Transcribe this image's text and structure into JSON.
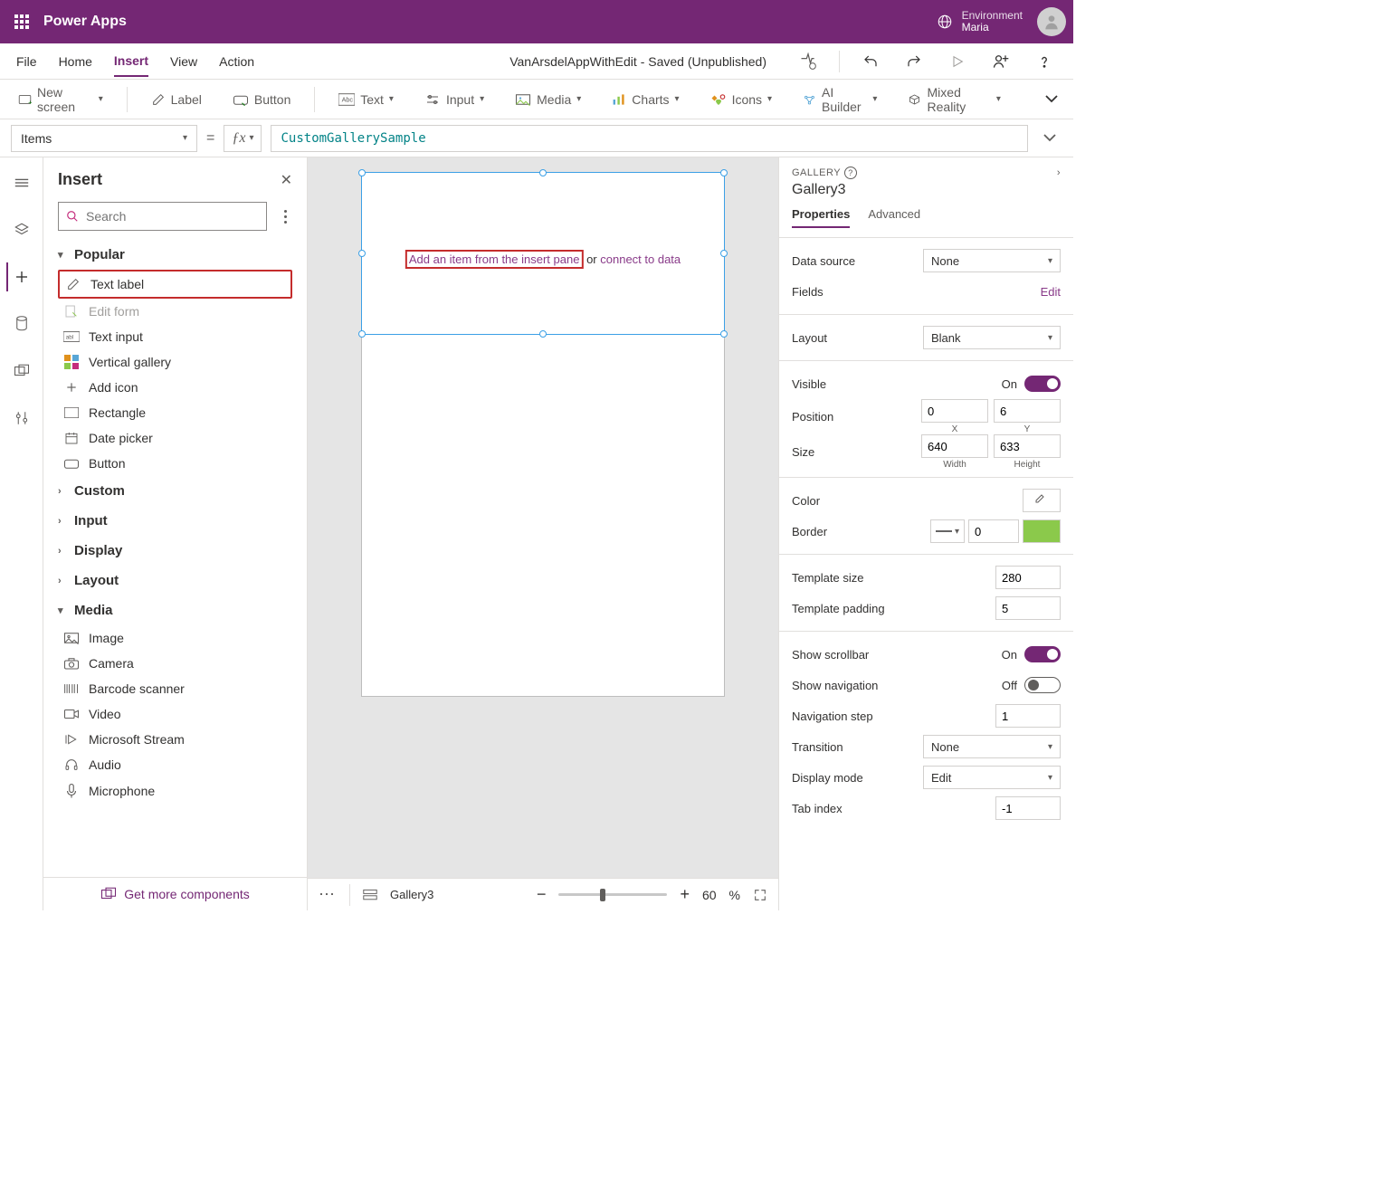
{
  "top": {
    "app_title": "Power Apps",
    "env_label": "Environment",
    "env_name": "Maria"
  },
  "menu": {
    "file": "File",
    "home": "Home",
    "insert": "Insert",
    "view": "View",
    "action": "Action",
    "doc": "VanArsdelAppWithEdit - Saved (Unpublished)"
  },
  "ribbon": {
    "new_screen": "New screen",
    "label": "Label",
    "button": "Button",
    "text": "Text",
    "input": "Input",
    "media": "Media",
    "charts": "Charts",
    "icons": "Icons",
    "ai_builder": "AI Builder",
    "mixed_reality": "Mixed Reality"
  },
  "formula": {
    "property": "Items",
    "value": "CustomGallerySample"
  },
  "panel": {
    "title": "Insert",
    "search_ph": "Search",
    "foot": "Get more components",
    "cats": {
      "popular": "Popular",
      "custom": "Custom",
      "input": "Input",
      "display": "Display",
      "layout": "Layout",
      "media": "Media"
    },
    "popular_items": {
      "text_label": "Text label",
      "edit_form": "Edit form",
      "text_input": "Text input",
      "vertical_gallery": "Vertical gallery",
      "add_icon": "Add icon",
      "rectangle": "Rectangle",
      "date_picker": "Date picker",
      "button": "Button"
    },
    "media_items": {
      "image": "Image",
      "camera": "Camera",
      "barcode": "Barcode scanner",
      "video": "Video",
      "ms_stream": "Microsoft Stream",
      "audio": "Audio",
      "microphone": "Microphone"
    }
  },
  "canvas": {
    "hint_boxed": "Add an item from the insert pane",
    "hint_mid": " or ",
    "hint_link": "connect to data",
    "crumb": "Gallery3",
    "zoom": "60",
    "pct": "%"
  },
  "props": {
    "ctx": "GALLERY",
    "name": "Gallery3",
    "tabs": {
      "properties": "Properties",
      "advanced": "Advanced"
    },
    "labels": {
      "data_source": "Data source",
      "fields": "Fields",
      "edit": "Edit",
      "layout": "Layout",
      "visible": "Visible",
      "position": "Position",
      "size": "Size",
      "x": "X",
      "y": "Y",
      "width": "Width",
      "height": "Height",
      "color": "Color",
      "border": "Border",
      "template_size": "Template size",
      "template_padding": "Template padding",
      "show_scrollbar": "Show scrollbar",
      "show_navigation": "Show navigation",
      "navigation_step": "Navigation step",
      "transition": "Transition",
      "display_mode": "Display mode",
      "tab_index": "Tab index",
      "on": "On",
      "off": "Off"
    },
    "values": {
      "data_source": "None",
      "layout": "Blank",
      "pos_x": "0",
      "pos_y": "6",
      "size_w": "640",
      "size_h": "633",
      "border_w": "0",
      "template_size": "280",
      "template_padding": "5",
      "navigation_step": "1",
      "transition": "None",
      "display_mode": "Edit",
      "tab_index": "-1"
    }
  }
}
